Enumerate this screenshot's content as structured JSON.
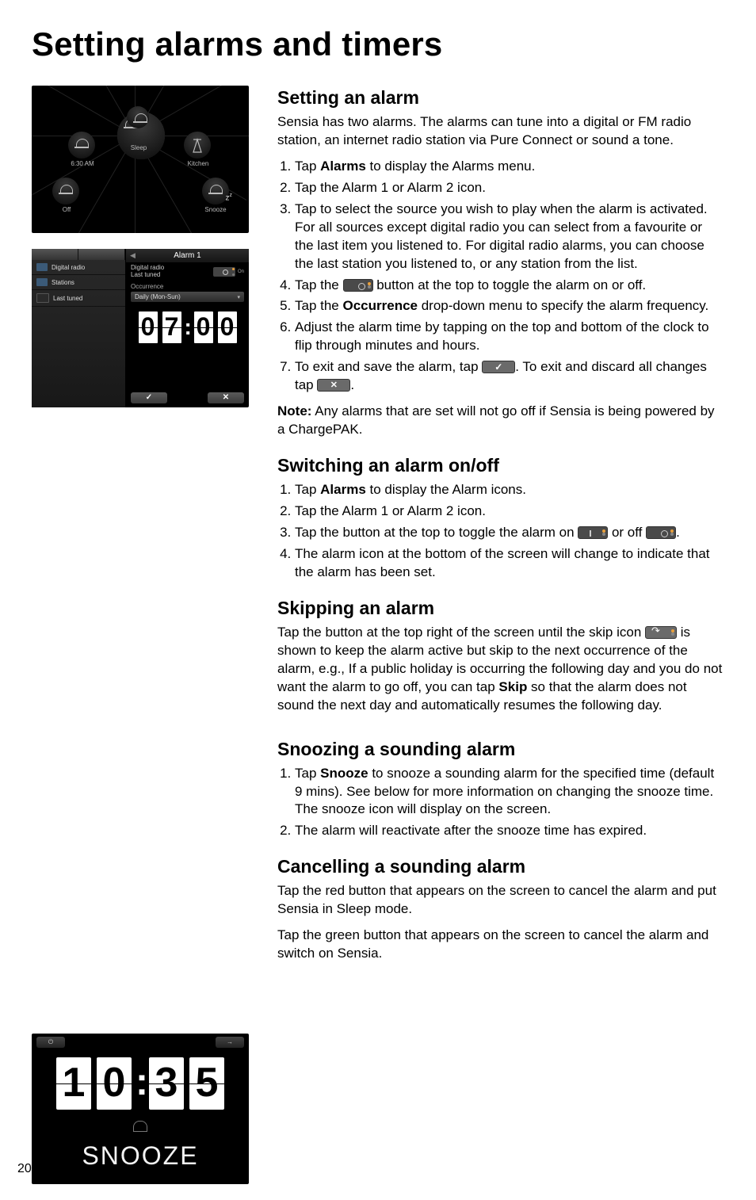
{
  "page_title": "Setting alarms and timers",
  "page_number": "20",
  "shot1": {
    "sleep_label": "Sleep",
    "kitchen_label": "Kitchen",
    "alarm1_time": "6:30 AM",
    "off_label": "Off",
    "snooze_label": "Snooze"
  },
  "shot2": {
    "title": "Alarm 1",
    "sidebar_items": [
      "Digital radio",
      "Stations",
      "Last tuned"
    ],
    "source_line1": "Digital radio",
    "source_line2": "Last tuned",
    "toggle_state": "On",
    "occurrence_label": "Occurrence",
    "occurrence_value": "Daily (Mon-Sun)",
    "time_digits": [
      "0",
      "7",
      "0",
      "0"
    ],
    "confirm": "✓",
    "cancel": "✕"
  },
  "shot3": {
    "time_digits": [
      "1",
      "0",
      "3",
      "5"
    ],
    "snooze_label": "SNOOZE",
    "power_icon": "⏻",
    "arrow_icon": "→"
  },
  "section1": {
    "heading": "Setting an alarm",
    "intro": "Sensia has two alarms. The alarms can tune into a digital or FM radio station, an internet radio station via Pure Connect or sound a tone.",
    "step1_a": "Tap ",
    "step1_b": "Alarms",
    "step1_c": " to display the Alarms menu.",
    "step2": "Tap the Alarm 1 or Alarm 2 icon.",
    "step3": "Tap to select the source you wish to play when the alarm is activated. For all sources except digital radio you can select from a favourite or the last item you listened to. For digital radio alarms, you can choose the last station you listened to, or any station from the list.",
    "step4_a": "Tap the ",
    "step4_b": " button at the top to toggle the alarm on or off.",
    "step5_a": "Tap the ",
    "step5_b": "Occurrence",
    "step5_c": " drop-down menu to specify the alarm frequency.",
    "step6": "Adjust the alarm time by tapping on the top and bottom of the clock to flip through minutes and hours.",
    "step7_a": "To exit and save the alarm, tap ",
    "step7_b": ". To exit and discard all changes tap ",
    "step7_c": ".",
    "note_b": "Note:",
    "note": " Any alarms that are set will not go off if Sensia is being powered by a ChargePAK."
  },
  "section2": {
    "heading": "Switching an alarm on/off",
    "step1_a": "Tap ",
    "step1_b": "Alarms",
    "step1_c": " to display the Alarm icons.",
    "step2": "Tap the Alarm 1 or Alarm 2 icon.",
    "step3_a": "Tap the button at the top to toggle the alarm on ",
    "step3_b": " or off ",
    "step3_c": ".",
    "step4": "The alarm icon at the bottom of the screen will change to indicate that the alarm has been set."
  },
  "section3": {
    "heading": "Skipping an alarm",
    "p_a": "Tap the button at the top right of the screen until the skip icon ",
    "p_b": " is shown to keep the alarm active but skip to the next occurrence of the alarm, e.g., If a public holiday is occurring the following day and you do not want the alarm to go off, you can tap ",
    "p_bold": "Skip",
    "p_c": " so that the alarm does not sound the next day and  automatically resumes the following day."
  },
  "section4": {
    "heading": "Snoozing a sounding alarm",
    "step1_a": "Tap ",
    "step1_b": "Snooze",
    "step1_c": " to snooze a sounding alarm for the specified time (default 9 mins).  See below for more information on changing the snooze time. The snooze icon will display on the screen.",
    "step2": "The alarm will reactivate after the snooze time has expired."
  },
  "section5": {
    "heading": "Cancelling a sounding alarm",
    "p1": "Tap the red button that appears on the screen to cancel the alarm and put Sensia in Sleep mode.",
    "p2": "Tap the green button that appears on the screen to cancel the alarm and switch on Sensia."
  }
}
